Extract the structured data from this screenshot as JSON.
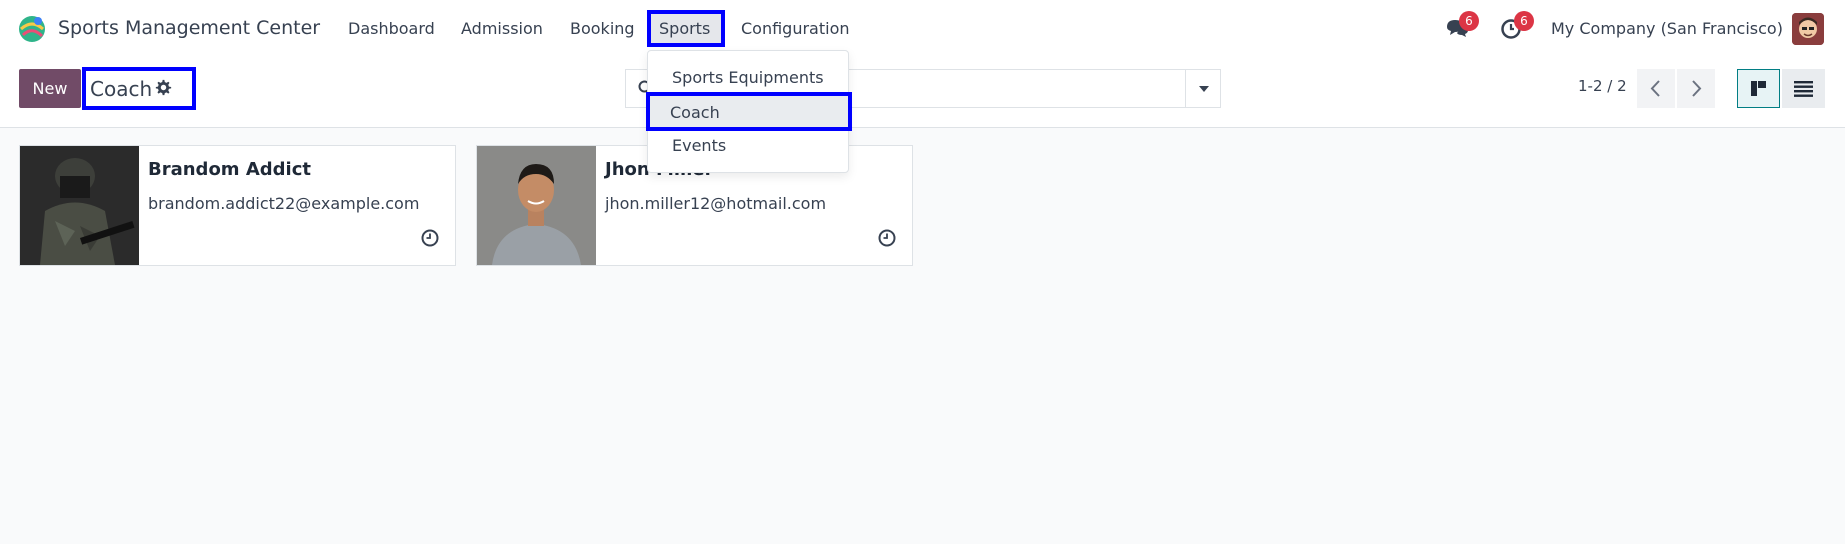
{
  "app": {
    "title": "Sports Management Center",
    "logo_icon": "sports-app-logo-icon"
  },
  "menu": {
    "items": [
      "Dashboard",
      "Admission",
      "Booking",
      "Sports",
      "Configuration"
    ],
    "active": "Sports"
  },
  "systray": {
    "messages_badge": "6",
    "activities_badge": "6",
    "company": "My Company (San Francisco)"
  },
  "control_panel": {
    "new_label": "New",
    "breadcrumb": "Coach",
    "search_placeholder": "",
    "pager": "1-2 / 2"
  },
  "dropdown": {
    "items": [
      "Sports Equipments",
      "Coach",
      "Events"
    ],
    "highlighted": "Coach"
  },
  "cards": [
    {
      "name": "Brandom Addict",
      "email": "brandom.addict22@example.com"
    },
    {
      "name": "Jhon Miller",
      "email": "jhon.miller12@hotmail.com"
    }
  ],
  "colors": {
    "brand": "#714b67",
    "highlight_border": "#0000ff",
    "badge": "#dc3545",
    "kanban_active": "#017e84"
  }
}
